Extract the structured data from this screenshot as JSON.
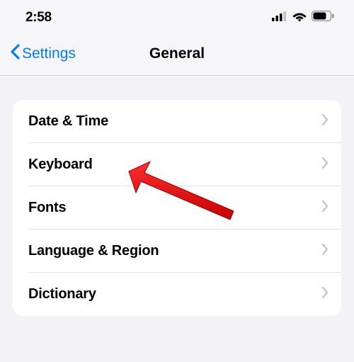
{
  "status": {
    "time": "2:58"
  },
  "nav": {
    "back_label": "Settings",
    "title": "General"
  },
  "list": {
    "items": [
      {
        "label": "Date & Time"
      },
      {
        "label": "Keyboard"
      },
      {
        "label": "Fonts"
      },
      {
        "label": "Language & Region"
      },
      {
        "label": "Dictionary"
      }
    ]
  }
}
